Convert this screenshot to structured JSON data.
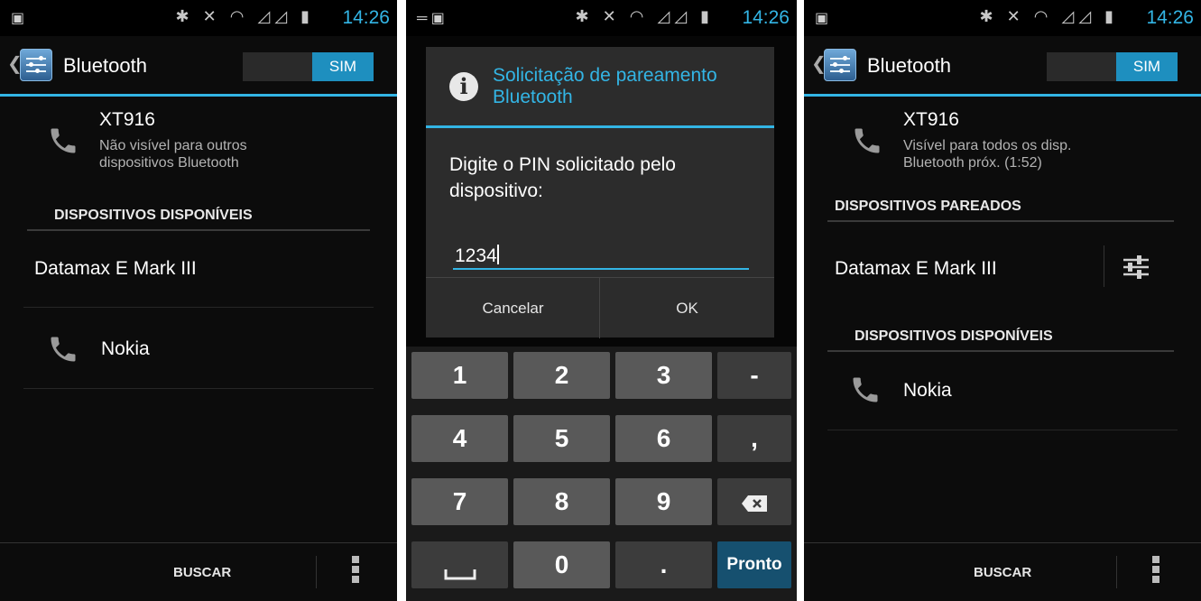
{
  "status": {
    "time": "14:26"
  },
  "screen1": {
    "title": "Bluetooth",
    "toggle": "SIM",
    "device_name": "XT916",
    "device_sub_1": "Não visível para outros",
    "device_sub_2": "dispositivos Bluetooth",
    "section_available": "DISPOSITIVOS DISPONÍVEIS",
    "devices": [
      "Datamax  E Mark III",
      "Nokia"
    ],
    "bottom_button": "BUSCAR"
  },
  "screen2": {
    "dialog_title_1": "Solicitação de pareamento",
    "dialog_title_2": "Bluetooth",
    "message_1": "Digite o PIN solicitado pelo",
    "message_2": "dispositivo:",
    "pin_value": "1234",
    "cancel": "Cancelar",
    "ok": "OK",
    "keys": {
      "k1": "1",
      "k2": "2",
      "k3": "3",
      "kdash": "-",
      "k4": "4",
      "k5": "5",
      "k6": "6",
      "kcomma": ",",
      "k7": "7",
      "k8": "8",
      "k9": "9",
      "k0": "0",
      "kdot": ".",
      "done": "Pronto"
    }
  },
  "screen3": {
    "title": "Bluetooth",
    "toggle": "SIM",
    "device_name": "XT916",
    "device_sub_1": "Visível para todos os disp.",
    "device_sub_2": "Bluetooth próx. (1:52)",
    "section_paired": "DISPOSITIVOS PAREADOS",
    "paired_device": "Datamax  E Mark III",
    "section_available": "DISPOSITIVOS DISPONÍVEIS",
    "available_device": "Nokia",
    "bottom_button": "BUSCAR"
  }
}
